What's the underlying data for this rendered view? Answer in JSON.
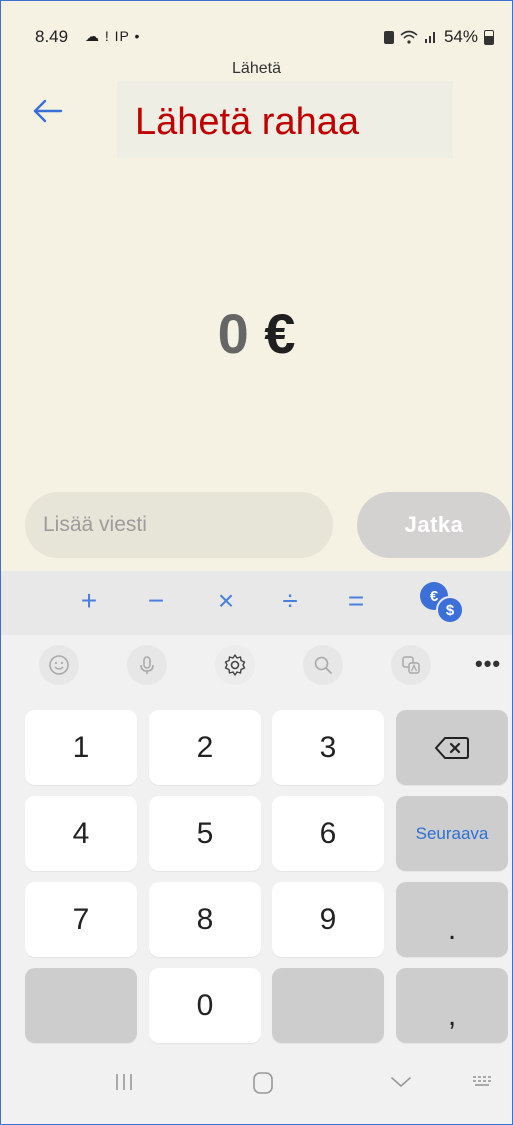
{
  "status_bar": {
    "time": "8.49",
    "left_icons": "☁ ! IP •",
    "battery": "54%",
    "icons": [
      "cloud-icon",
      "notification-icon",
      "wifi-icon",
      "signal-icon",
      "battery-icon"
    ]
  },
  "header": {
    "small_title": "Lähetä",
    "overlay_title": "Lähetä rahaa",
    "back_icon": "back-arrow-icon"
  },
  "amount": {
    "value": "0",
    "currency": "€"
  },
  "message": {
    "placeholder": "Lisää viesti",
    "value": ""
  },
  "continue_button": {
    "label": "Jatka"
  },
  "keyboard": {
    "calc_keys": [
      "+",
      "−",
      "×",
      "÷",
      "="
    ],
    "currency_icon": {
      "euro": "€",
      "dollar": "$"
    },
    "toolbar": [
      "emoji-icon",
      "microphone-icon",
      "settings-icon",
      "search-icon",
      "translate-icon"
    ],
    "more_label": "•••",
    "keys": {
      "k1": "1",
      "k2": "2",
      "k3": "3",
      "k4": "4",
      "k5": "5",
      "k6": "6",
      "k7": "7",
      "k8": "8",
      "k9": "9",
      "k0": "0",
      "next": "Seuraava",
      "dot": ".",
      "comma": ","
    }
  },
  "colors": {
    "accent": "#2d6fd6",
    "title_red": "#c00000",
    "background": "#f5f2e4"
  }
}
